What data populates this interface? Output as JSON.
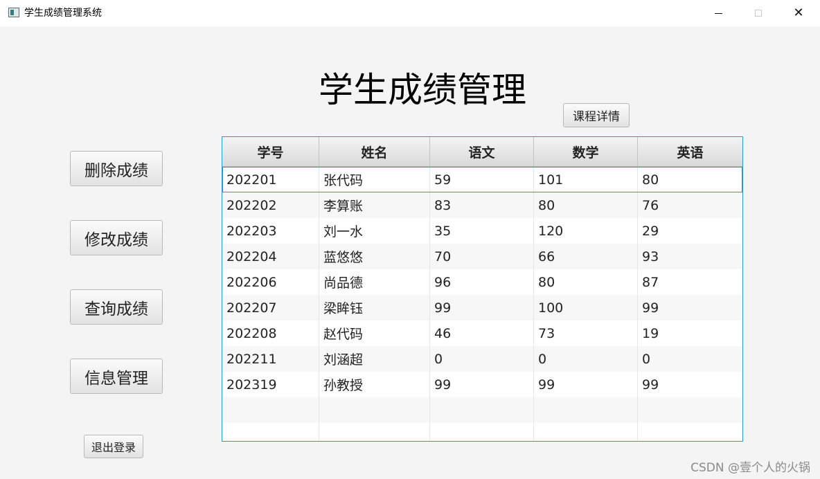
{
  "window": {
    "title": "学生成绩管理系统",
    "controls": {
      "minimize_icon": "minimize-icon",
      "maximize_icon": "maximize-icon",
      "close_icon": "close-icon",
      "close_glyph": "✕"
    }
  },
  "page": {
    "title": "学生成绩管理",
    "course_detail_label": "课程详情",
    "logout_label": "退出登录"
  },
  "sidebar": {
    "buttons": [
      {
        "label": "删除成绩"
      },
      {
        "label": "修改成绩"
      },
      {
        "label": "查询成绩"
      },
      {
        "label": "信息管理"
      }
    ]
  },
  "table": {
    "columns": [
      "学号",
      "姓名",
      "语文",
      "数学",
      "英语"
    ],
    "rows": [
      [
        "202201",
        "张代码",
        "59",
        "101",
        "80"
      ],
      [
        "202202",
        "李算账",
        "83",
        "80",
        "76"
      ],
      [
        "202203",
        "刘一水",
        "35",
        "120",
        "29"
      ],
      [
        "202204",
        "蓝悠悠",
        "70",
        "66",
        "93"
      ],
      [
        "202206",
        "尚品德",
        "96",
        "80",
        "87"
      ],
      [
        "202207",
        "梁眸钰",
        "99",
        "100",
        "99"
      ],
      [
        "202208",
        "赵代码",
        "46",
        "73",
        "19"
      ],
      [
        "202211",
        "刘涵超",
        "0",
        "0",
        "0"
      ],
      [
        "202319",
        "孙教授",
        "99",
        "99",
        "99"
      ],
      [
        "",
        "",
        "",
        "",
        ""
      ],
      [
        "",
        "",
        "",
        "",
        ""
      ]
    ],
    "selected_row": 0,
    "border_color": "#2a98c8"
  },
  "watermark": "CSDN @壹个人的火锅"
}
